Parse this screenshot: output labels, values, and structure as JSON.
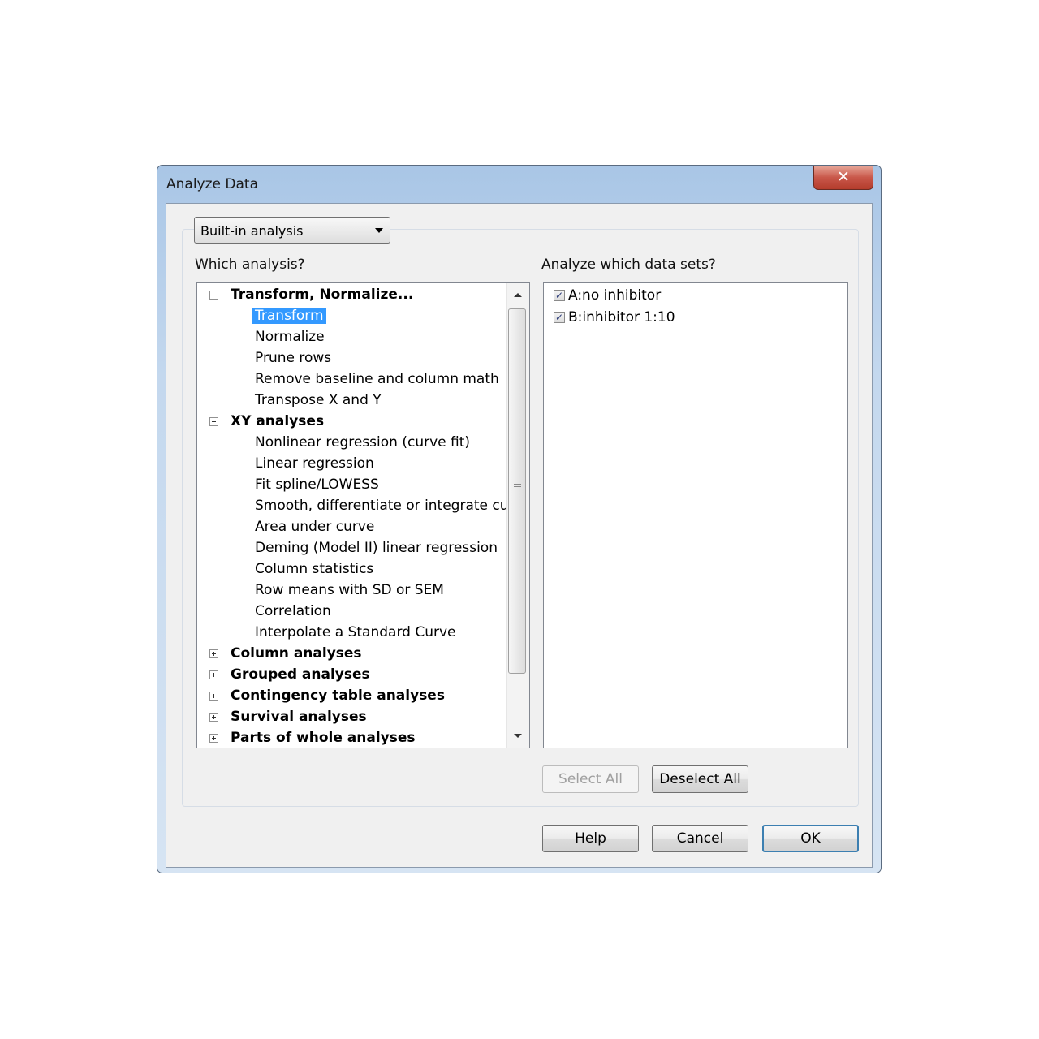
{
  "window": {
    "title": "Analyze Data",
    "close_glyph": "✕"
  },
  "combo": {
    "selected": "Built-in analysis"
  },
  "labels": {
    "which_analysis": "Which analysis?",
    "which_datasets": "Analyze which data sets?"
  },
  "tree": {
    "categories": [
      {
        "label": "Transform, Normalize...",
        "expanded": true,
        "items": [
          "Transform",
          "Normalize",
          "Prune rows",
          "Remove baseline and column math",
          "Transpose X and Y"
        ]
      },
      {
        "label": "XY analyses",
        "expanded": true,
        "items": [
          "Nonlinear regression (curve fit)",
          "Linear regression",
          "Fit spline/LOWESS",
          "Smooth, differentiate or integrate curve",
          "Area under curve",
          "Deming (Model II) linear regression",
          "Column statistics",
          "Row means with SD or SEM",
          "Correlation",
          "Interpolate a Standard Curve"
        ]
      },
      {
        "label": "Column analyses",
        "expanded": false,
        "items": []
      },
      {
        "label": "Grouped analyses",
        "expanded": false,
        "items": []
      },
      {
        "label": "Contingency table analyses",
        "expanded": false,
        "items": []
      },
      {
        "label": "Survival analyses",
        "expanded": false,
        "items": []
      },
      {
        "label": "Parts of whole analyses",
        "expanded": false,
        "items": []
      }
    ],
    "selected_item": "Transform"
  },
  "datasets": [
    {
      "label": "A:no inhibitor",
      "checked": true
    },
    {
      "label": "B:inhibitor 1:10",
      "checked": true
    }
  ],
  "check_glyph": "✓",
  "buttons": {
    "select_all": "Select All",
    "deselect_all": "Deselect All",
    "help": "Help",
    "cancel": "Cancel",
    "ok": "OK"
  }
}
